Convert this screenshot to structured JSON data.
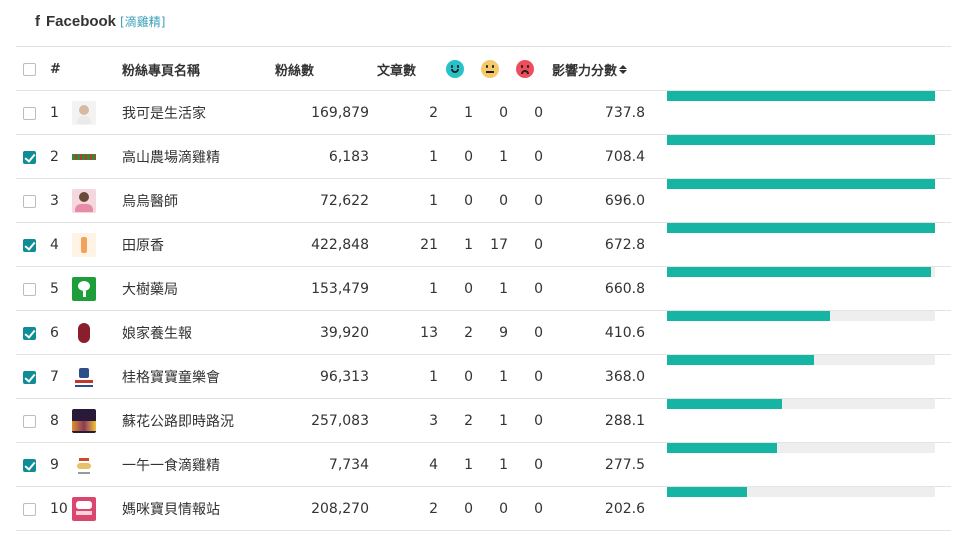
{
  "header": {
    "icon": "facebook-icon",
    "platform": "Facebook",
    "tag": "[滴雞精]"
  },
  "columns": {
    "index": "#",
    "page_name": "粉絲專頁名稱",
    "fans": "粉絲數",
    "posts": "文章數",
    "influence": "影響力分數"
  },
  "sentiment_icons": {
    "positive": "smile-icon",
    "neutral": "neutral-face-icon",
    "negative": "frown-icon"
  },
  "colors": {
    "accent": "#16b4a2",
    "checkbox": "#0f8d96",
    "positive": "#27c2c9",
    "neutral": "#f5c96a",
    "negative": "#ef4d5b",
    "tag": "#3aa0b8"
  },
  "rows": [
    {
      "rank": "1",
      "name": "我可是生活家",
      "fans": "169,879",
      "posts": "2",
      "pos": "1",
      "neu": "0",
      "neg": "0",
      "score": "737.8",
      "checked": false,
      "avatar": "avatar-person",
      "ratio": 1.0
    },
    {
      "rank": "2",
      "name": "高山農場滴雞精",
      "fans": "6,183",
      "posts": "1",
      "pos": "0",
      "neu": "1",
      "neg": "0",
      "score": "708.4",
      "checked": true,
      "avatar": "avatar-logo-green",
      "ratio": 1.0
    },
    {
      "rank": "3",
      "name": "烏烏醫師",
      "fans": "72,622",
      "posts": "1",
      "pos": "0",
      "neu": "0",
      "neg": "0",
      "score": "696.0",
      "checked": false,
      "avatar": "avatar-doctor",
      "ratio": 1.0
    },
    {
      "rank": "4",
      "name": "田原香",
      "fans": "422,848",
      "posts": "21",
      "pos": "1",
      "neu": "17",
      "neg": "0",
      "score": "672.8",
      "checked": true,
      "avatar": "avatar-tianyuanxiang",
      "ratio": 1.0
    },
    {
      "rank": "5",
      "name": "大樹藥局",
      "fans": "153,479",
      "posts": "1",
      "pos": "0",
      "neu": "1",
      "neg": "0",
      "score": "660.8",
      "checked": false,
      "avatar": "avatar-tree-green",
      "ratio": 0.985
    },
    {
      "rank": "6",
      "name": "娘家養生報",
      "fans": "39,920",
      "posts": "13",
      "pos": "2",
      "neu": "9",
      "neg": "0",
      "score": "410.6",
      "checked": true,
      "avatar": "avatar-niangjia",
      "ratio": 0.61
    },
    {
      "rank": "7",
      "name": "桂格寶寶童樂會",
      "fans": "96,313",
      "posts": "1",
      "pos": "0",
      "neu": "1",
      "neg": "0",
      "score": "368.0",
      "checked": true,
      "avatar": "avatar-quaker",
      "ratio": 0.547
    },
    {
      "rank": "8",
      "name": "蘇花公路即時路況",
      "fans": "257,083",
      "posts": "3",
      "pos": "2",
      "neu": "1",
      "neg": "0",
      "score": "288.1",
      "checked": false,
      "avatar": "avatar-road-night",
      "ratio": 0.428
    },
    {
      "rank": "9",
      "name": "一午一食滴雞精",
      "fans": "7,734",
      "posts": "4",
      "pos": "1",
      "neu": "1",
      "neg": "0",
      "score": "277.5",
      "checked": true,
      "avatar": "avatar-yiwu",
      "ratio": 0.412
    },
    {
      "rank": "10",
      "name": "媽咪寶貝情報站",
      "fans": "208,270",
      "posts": "2",
      "pos": "0",
      "neu": "0",
      "neg": "0",
      "score": "202.6",
      "checked": false,
      "avatar": "avatar-mommy-baby",
      "ratio": 0.3
    }
  ]
}
